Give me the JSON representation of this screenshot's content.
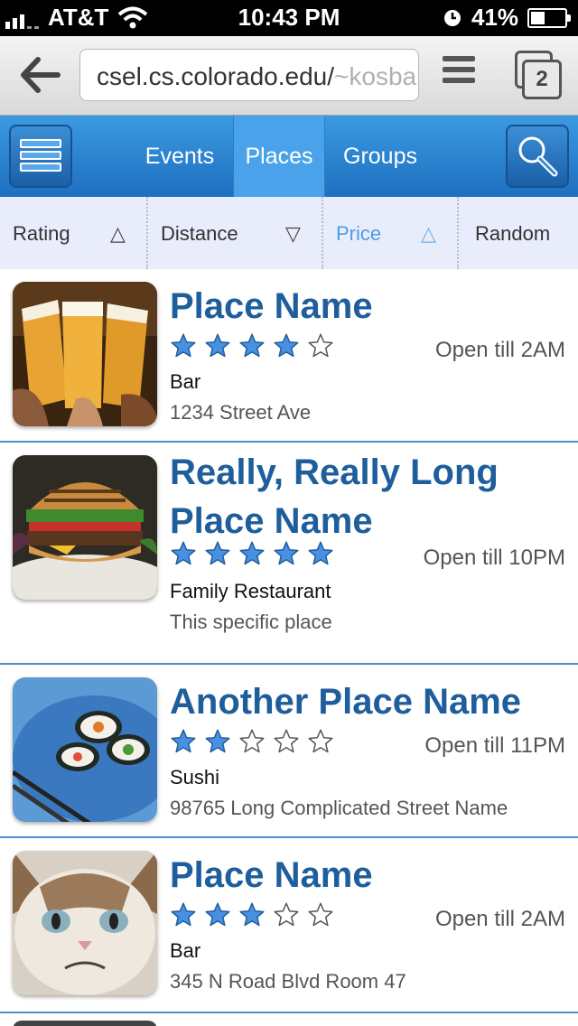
{
  "status_bar": {
    "carrier": "AT&T",
    "time": "10:43 PM",
    "battery": "41%",
    "battery_level": 0.41
  },
  "browser": {
    "url_visible": "csel.cs.colorado.edu/",
    "url_faded": "~kosba",
    "tab_count": "2"
  },
  "nav": {
    "tabs": [
      {
        "label": "Events"
      },
      {
        "label": "Places"
      },
      {
        "label": "Groups"
      }
    ],
    "active_tab": "Places"
  },
  "sort": {
    "items": [
      {
        "label": "Rating",
        "arrow": "△"
      },
      {
        "label": "Distance",
        "arrow": "▽"
      },
      {
        "label": "Price",
        "arrow": "△"
      },
      {
        "label": "Random",
        "arrow": ""
      }
    ],
    "active": "Price"
  },
  "places": [
    {
      "name": "Place Name",
      "rating": 4,
      "hours": "Open till 2AM",
      "category": "Bar",
      "address": "1234 Street Ave",
      "image": "beer-mugs"
    },
    {
      "name": "Really, Really Long Place Name",
      "rating": 5,
      "hours": "Open till 10PM",
      "category": "Family Restaurant",
      "address": "This specific place",
      "image": "burger"
    },
    {
      "name": "Another Place Name",
      "rating": 2,
      "hours": "Open till 11PM",
      "category": "Sushi",
      "address": "98765 Long Complicated Street Name",
      "image": "sushi"
    },
    {
      "name": "Place Name",
      "rating": 3,
      "hours": "Open till 2AM",
      "category": "Bar",
      "address": "345 N Road Blvd Room 47",
      "image": "grumpy-cat"
    }
  ],
  "colors": {
    "accent": "#1f5e9c",
    "nav_blue": "#2a84d2",
    "star_blue": "#4a90e2"
  }
}
